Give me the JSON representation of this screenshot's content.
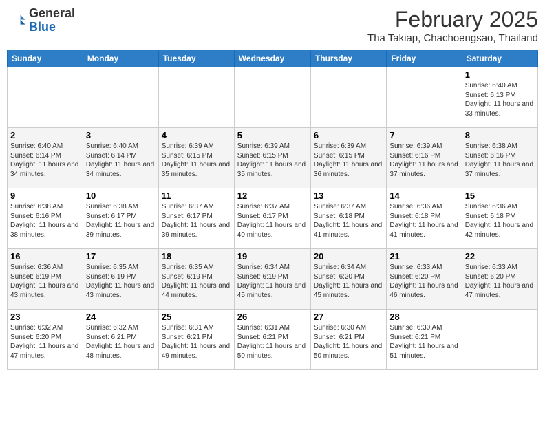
{
  "header": {
    "logo_general": "General",
    "logo_blue": "Blue",
    "month_title": "February 2025",
    "location": "Tha Takiap, Chachoengsao, Thailand"
  },
  "days_of_week": [
    "Sunday",
    "Monday",
    "Tuesday",
    "Wednesday",
    "Thursday",
    "Friday",
    "Saturday"
  ],
  "weeks": [
    [
      {
        "day": "",
        "info": ""
      },
      {
        "day": "",
        "info": ""
      },
      {
        "day": "",
        "info": ""
      },
      {
        "day": "",
        "info": ""
      },
      {
        "day": "",
        "info": ""
      },
      {
        "day": "",
        "info": ""
      },
      {
        "day": "1",
        "info": "Sunrise: 6:40 AM\nSunset: 6:13 PM\nDaylight: 11 hours\nand 33 minutes."
      }
    ],
    [
      {
        "day": "2",
        "info": "Sunrise: 6:40 AM\nSunset: 6:14 PM\nDaylight: 11 hours\nand 34 minutes."
      },
      {
        "day": "3",
        "info": "Sunrise: 6:40 AM\nSunset: 6:14 PM\nDaylight: 11 hours\nand 34 minutes."
      },
      {
        "day": "4",
        "info": "Sunrise: 6:39 AM\nSunset: 6:15 PM\nDaylight: 11 hours\nand 35 minutes."
      },
      {
        "day": "5",
        "info": "Sunrise: 6:39 AM\nSunset: 6:15 PM\nDaylight: 11 hours\nand 35 minutes."
      },
      {
        "day": "6",
        "info": "Sunrise: 6:39 AM\nSunset: 6:15 PM\nDaylight: 11 hours\nand 36 minutes."
      },
      {
        "day": "7",
        "info": "Sunrise: 6:39 AM\nSunset: 6:16 PM\nDaylight: 11 hours\nand 37 minutes."
      },
      {
        "day": "8",
        "info": "Sunrise: 6:38 AM\nSunset: 6:16 PM\nDaylight: 11 hours\nand 37 minutes."
      }
    ],
    [
      {
        "day": "9",
        "info": "Sunrise: 6:38 AM\nSunset: 6:16 PM\nDaylight: 11 hours\nand 38 minutes."
      },
      {
        "day": "10",
        "info": "Sunrise: 6:38 AM\nSunset: 6:17 PM\nDaylight: 11 hours\nand 39 minutes."
      },
      {
        "day": "11",
        "info": "Sunrise: 6:37 AM\nSunset: 6:17 PM\nDaylight: 11 hours\nand 39 minutes."
      },
      {
        "day": "12",
        "info": "Sunrise: 6:37 AM\nSunset: 6:17 PM\nDaylight: 11 hours\nand 40 minutes."
      },
      {
        "day": "13",
        "info": "Sunrise: 6:37 AM\nSunset: 6:18 PM\nDaylight: 11 hours\nand 41 minutes."
      },
      {
        "day": "14",
        "info": "Sunrise: 6:36 AM\nSunset: 6:18 PM\nDaylight: 11 hours\nand 41 minutes."
      },
      {
        "day": "15",
        "info": "Sunrise: 6:36 AM\nSunset: 6:18 PM\nDaylight: 11 hours\nand 42 minutes."
      }
    ],
    [
      {
        "day": "16",
        "info": "Sunrise: 6:36 AM\nSunset: 6:19 PM\nDaylight: 11 hours\nand 43 minutes."
      },
      {
        "day": "17",
        "info": "Sunrise: 6:35 AM\nSunset: 6:19 PM\nDaylight: 11 hours\nand 43 minutes."
      },
      {
        "day": "18",
        "info": "Sunrise: 6:35 AM\nSunset: 6:19 PM\nDaylight: 11 hours\nand 44 minutes."
      },
      {
        "day": "19",
        "info": "Sunrise: 6:34 AM\nSunset: 6:19 PM\nDaylight: 11 hours\nand 45 minutes."
      },
      {
        "day": "20",
        "info": "Sunrise: 6:34 AM\nSunset: 6:20 PM\nDaylight: 11 hours\nand 45 minutes."
      },
      {
        "day": "21",
        "info": "Sunrise: 6:33 AM\nSunset: 6:20 PM\nDaylight: 11 hours\nand 46 minutes."
      },
      {
        "day": "22",
        "info": "Sunrise: 6:33 AM\nSunset: 6:20 PM\nDaylight: 11 hours\nand 47 minutes."
      }
    ],
    [
      {
        "day": "23",
        "info": "Sunrise: 6:32 AM\nSunset: 6:20 PM\nDaylight: 11 hours\nand 47 minutes."
      },
      {
        "day": "24",
        "info": "Sunrise: 6:32 AM\nSunset: 6:21 PM\nDaylight: 11 hours\nand 48 minutes."
      },
      {
        "day": "25",
        "info": "Sunrise: 6:31 AM\nSunset: 6:21 PM\nDaylight: 11 hours\nand 49 minutes."
      },
      {
        "day": "26",
        "info": "Sunrise: 6:31 AM\nSunset: 6:21 PM\nDaylight: 11 hours\nand 50 minutes."
      },
      {
        "day": "27",
        "info": "Sunrise: 6:30 AM\nSunset: 6:21 PM\nDaylight: 11 hours\nand 50 minutes."
      },
      {
        "day": "28",
        "info": "Sunrise: 6:30 AM\nSunset: 6:21 PM\nDaylight: 11 hours\nand 51 minutes."
      },
      {
        "day": "",
        "info": ""
      }
    ]
  ]
}
